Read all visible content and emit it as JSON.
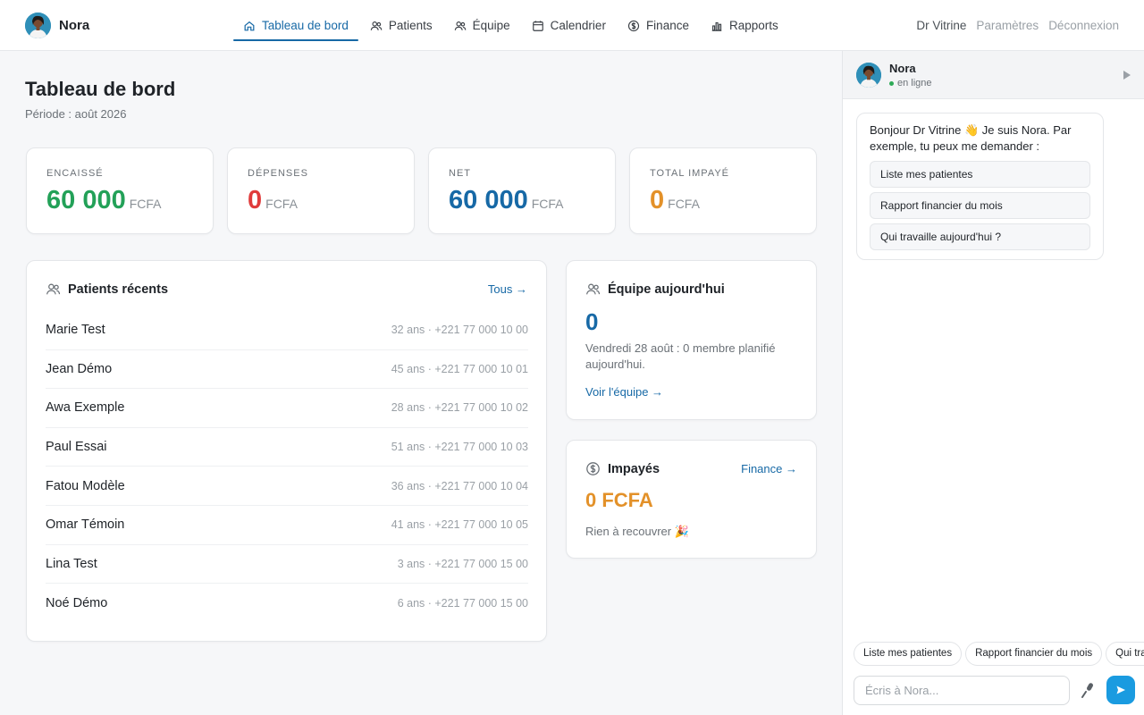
{
  "brand": {
    "name": "Nora",
    "icon": "avatar"
  },
  "nav": {
    "items": [
      {
        "label": "Tableau de bord",
        "icon": "home-icon",
        "active": true
      },
      {
        "label": "Patients",
        "icon": "users-icon",
        "active": false
      },
      {
        "label": "Équipe",
        "icon": "users-icon",
        "active": false
      },
      {
        "label": "Calendrier",
        "icon": "calendar-icon",
        "active": false
      },
      {
        "label": "Finance",
        "icon": "dollar-icon",
        "active": false
      },
      {
        "label": "Rapports",
        "icon": "bar-chart-icon",
        "active": false
      }
    ],
    "user": "Dr Vitrine",
    "settings": "Paramètres",
    "logout": "Déconnexion"
  },
  "page": {
    "title": "Tableau de bord",
    "period": "Période : août 2026"
  },
  "stats": [
    {
      "label": "ENCAISSÉ",
      "value": "60 000",
      "currency": "FCFA",
      "color": "#23a158"
    },
    {
      "label": "DÉPENSES",
      "value": "0",
      "currency": "FCFA",
      "color": "#e03b3b"
    },
    {
      "label": "NET",
      "value": "60 000",
      "currency": "FCFA",
      "color": "#1769a6"
    },
    {
      "label": "TOTAL IMPAYÉ",
      "value": "0",
      "currency": "FCFA",
      "color": "#e39129"
    }
  ],
  "patients": {
    "title": "Patients récents",
    "link": "Tous →",
    "rows": [
      {
        "name": "Marie Test",
        "meta": "32 ans · +221 77 000 10 00"
      },
      {
        "name": "Jean Démo",
        "meta": "45 ans · +221 77 000 10 01"
      },
      {
        "name": "Awa Exemple",
        "meta": "28 ans · +221 77 000 10 02"
      },
      {
        "name": "Paul Essai",
        "meta": "51 ans · +221 77 000 10 03"
      },
      {
        "name": "Fatou Modèle",
        "meta": "36 ans · +221 77 000 10 04"
      },
      {
        "name": "Omar Témoin",
        "meta": "41 ans · +221 77 000 10 05"
      },
      {
        "name": "Lina Test",
        "meta": "3 ans · +221 77 000 15 00"
      },
      {
        "name": "Noé Démo",
        "meta": "6 ans · +221 77 000 15 00"
      }
    ]
  },
  "team": {
    "title": "Équipe aujourd'hui",
    "count": "0",
    "description": "Vendredi 28 août : 0 membre planifié aujourd'hui.",
    "link": "Voir l'équipe →"
  },
  "unpaid": {
    "title": "Impayés",
    "link": "Finance →",
    "amount": "0 FCFA",
    "note": "Rien à recouvrer 🎉"
  },
  "chat": {
    "name": "Nora",
    "status": "en ligne",
    "message": "Bonjour Dr Vitrine 👋 Je suis Nora. Par exemple, tu peux me demander :",
    "suggestions": [
      "Liste mes patientes",
      "Rapport financier du mois",
      "Qui travaille aujourd'hui ?"
    ],
    "chips": [
      "Liste mes patientes",
      "Rapport financier du mois",
      "Qui travaille aujourd'hui ?"
    ],
    "input_placeholder": "Écris à Nora...",
    "accent": "#1a9be0"
  }
}
